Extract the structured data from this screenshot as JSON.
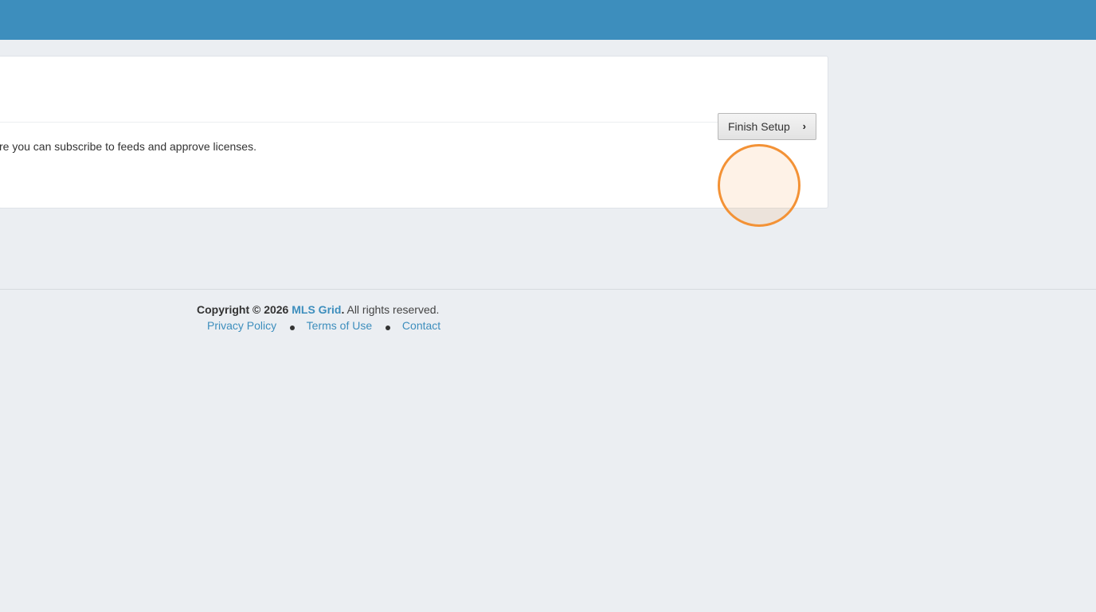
{
  "panel": {
    "text": "re you can subscribe to feeds and approve licenses.",
    "finish_button": "Finish Setup",
    "chevron_icon": "chevron-right-icon"
  },
  "footer": {
    "copyright_prefix": "Copyright © 2026",
    "brand": "MLS Grid",
    "period": ".",
    "rights": " All rights reserved.",
    "links": [
      "Privacy Policy",
      "Terms of Use",
      "Contact"
    ]
  },
  "colors": {
    "topbar": "#3d8ebd",
    "link": "#3d8ebd",
    "highlight_ring": "#f39236",
    "background": "#ebeef2"
  }
}
